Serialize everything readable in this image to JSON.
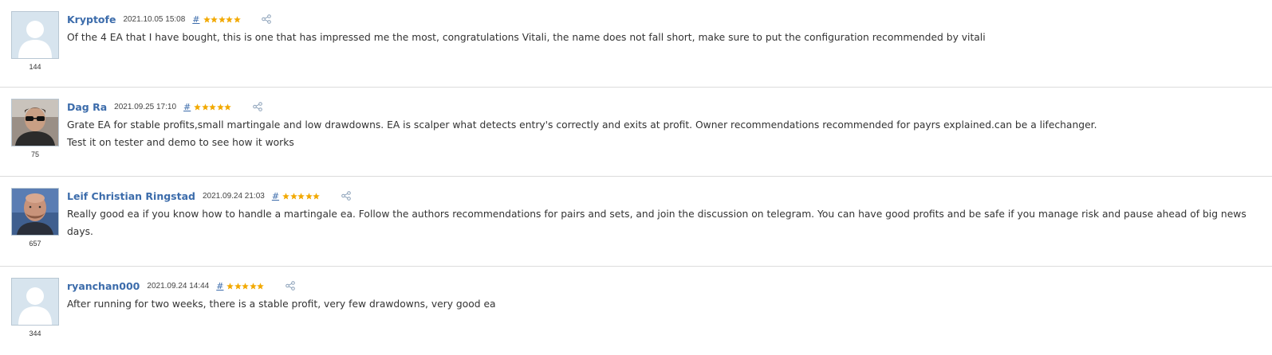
{
  "reviews": [
    {
      "author": "Kryptofe",
      "date": "2021.10.05 15:08",
      "hash": "#",
      "stars": 5,
      "rating_count": "144",
      "avatar": "default-avatar",
      "lines": [
        "Of the 4 EA that I have bought, this is one that has impressed me the most, congratulations Vitali, the name does not fall short, make sure to put the configuration recommended by vitali"
      ]
    },
    {
      "author": "Dag Ra",
      "date": "2021.09.25 17:10",
      "hash": "#",
      "stars": 5,
      "rating_count": "75",
      "avatar": "photo-sunglasses",
      "lines": [
        "Grate EA for stable profits,small martingale and low drawdowns. EA is scalper what detects entry's correctly and exits at profit. Owner recommendations recommended for payrs explained.can be a lifechanger.",
        "Test it on tester and demo to see how it works"
      ]
    },
    {
      "author": "Leif Christian Ringstad",
      "date": "2021.09.24 21:03",
      "hash": "#",
      "stars": 5,
      "rating_count": "657",
      "avatar": "photo-bald",
      "lines": [
        "Really good ea if you know how to handle a martingale ea. Follow the authors recommendations for pairs and sets, and join the discussion on telegram. You can have good profits and be safe if you manage risk and pause ahead of big news",
        "days."
      ]
    },
    {
      "author": "ryanchan000",
      "date": "2021.09.24 14:44",
      "hash": "#",
      "stars": 5,
      "rating_count": "344",
      "avatar": "default-avatar",
      "lines": [
        "After running for two weeks, there is a stable profit, very few drawdowns, very good ea"
      ]
    }
  ],
  "colors": {
    "author_link": "#3c6cab",
    "star": "#f2a900",
    "divider": "#dcdcdc",
    "avatar_bg": "#d7e4ee"
  }
}
